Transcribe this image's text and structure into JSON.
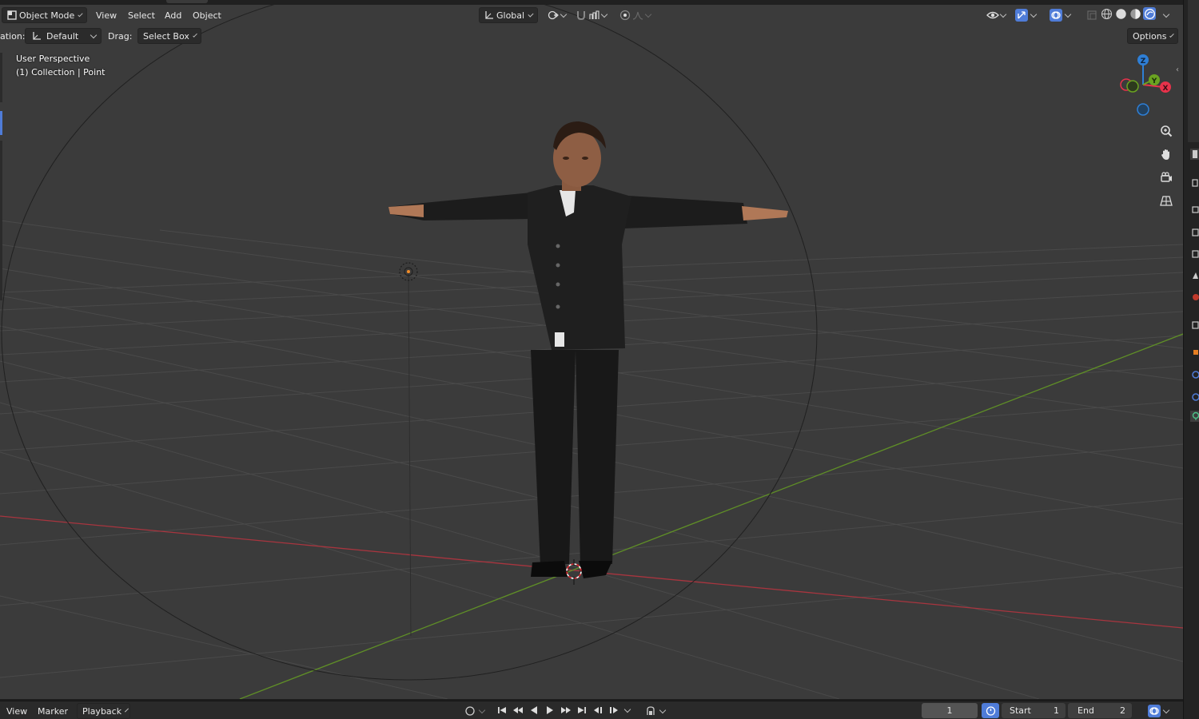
{
  "header": {
    "mode": "Object Mode",
    "menus": [
      "View",
      "Select",
      "Add",
      "Object"
    ],
    "orientation": "Global"
  },
  "toolbar": {
    "orientation_label": "ation:",
    "orientation_value": "Default",
    "drag_label": "Drag:",
    "drag_value": "Select Box",
    "options": "Options"
  },
  "viewport": {
    "perspective": "User Perspective",
    "collection": "(1) Collection | Point"
  },
  "navigation_gizmo": {
    "axes": [
      "Z",
      "Y",
      "X"
    ],
    "colors": {
      "x": "#e8324b",
      "y": "#6aa321",
      "z": "#2e7fd6"
    },
    "tools": [
      "zoom-icon",
      "hand-pan-icon",
      "camera-icon",
      "grid-ortho-icon"
    ]
  },
  "timeline": {
    "menus": [
      "View",
      "Marker",
      "Playback"
    ],
    "current_frame": "1",
    "start_label": "Start",
    "start_value": "1",
    "end_label": "End",
    "end_value": "2"
  },
  "colors": {
    "viewport_bg": "#3b3b3b",
    "accent_blue": "#4f7cd8"
  }
}
